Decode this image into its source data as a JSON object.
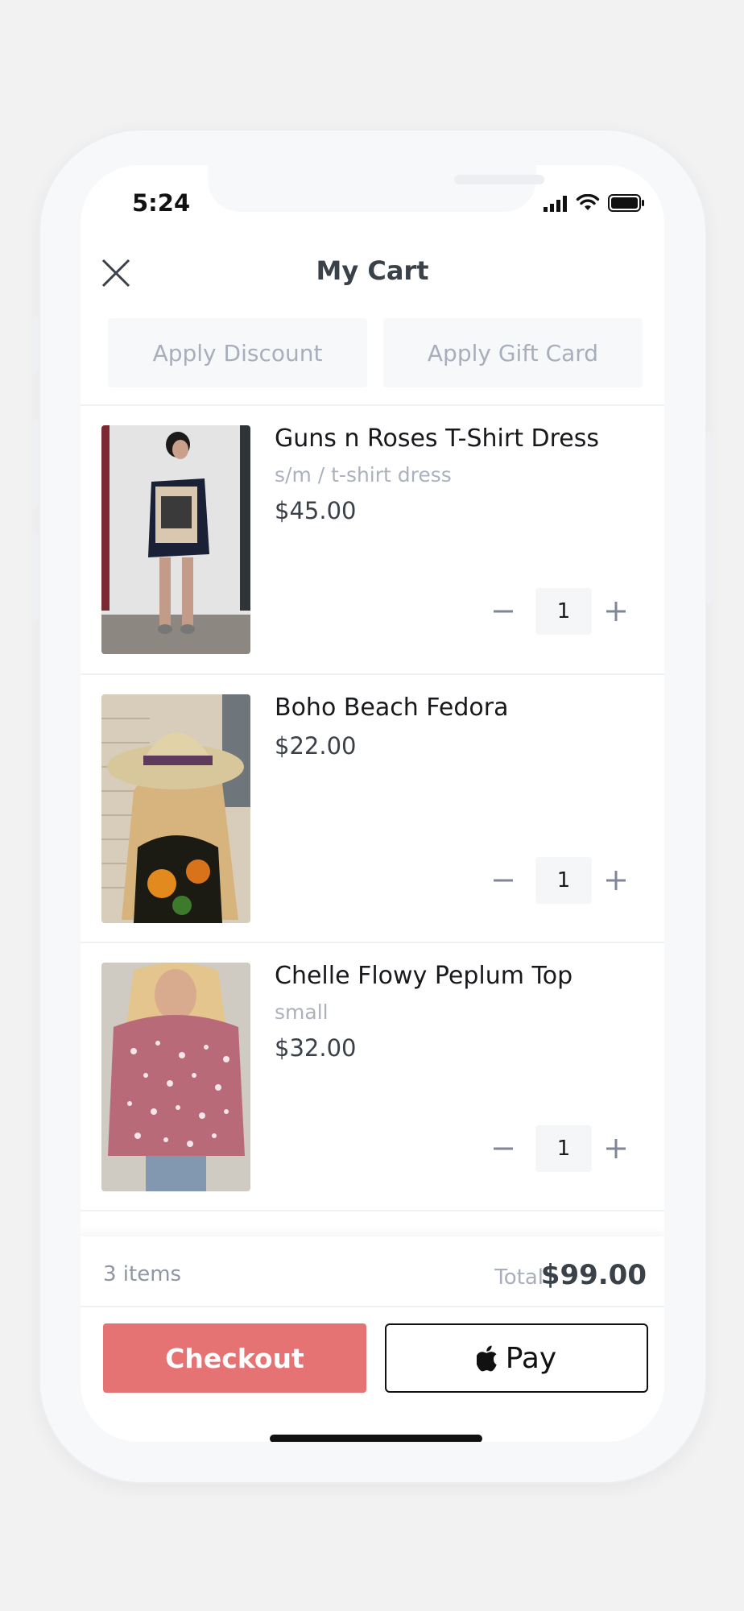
{
  "status_bar": {
    "time": "5:24"
  },
  "header": {
    "title": "My Cart"
  },
  "actions": {
    "discount_label": "Apply Discount",
    "gift_card_label": "Apply Gift Card"
  },
  "cart": {
    "items": [
      {
        "name": "Guns n Roses T-Shirt Dress",
        "variant": "s/m / t-shirt dress",
        "price": "$45.00",
        "quantity": "1"
      },
      {
        "name": "Boho Beach Fedora",
        "variant": "",
        "price": "$22.00",
        "quantity": "1"
      },
      {
        "name": "Chelle Flowy Peplum Top",
        "variant": "small",
        "price": "$32.00",
        "quantity": "1"
      }
    ]
  },
  "footer": {
    "items_count": "3 items",
    "total_label": "Total",
    "total_value": "$99.00",
    "checkout_label": "Checkout",
    "applepay_label": "Pay"
  },
  "colors": {
    "checkout": "#e57373",
    "text_dark": "#3b4149",
    "muted": "#a8aebb"
  }
}
